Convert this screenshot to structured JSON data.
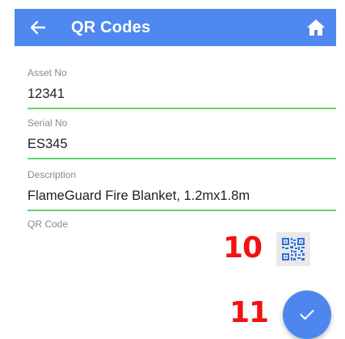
{
  "app_bar": {
    "title": "QR Codes",
    "back_icon": "arrow-left-icon",
    "home_icon": "home-icon",
    "color": "#4f88ef"
  },
  "form": {
    "asset_no": {
      "label": "Asset No",
      "value": "12341"
    },
    "serial_no": {
      "label": "Serial No",
      "value": "ES345"
    },
    "description": {
      "label": "Description",
      "value": "FlameGuard Fire Blanket, 1.2mx1.8m"
    },
    "qr_code": {
      "label": "QR Code",
      "icon": "qr-code-icon"
    },
    "underline_color": "#63d46b"
  },
  "annotations": {
    "step_10": "10",
    "step_11": "11",
    "color": "#f21111"
  },
  "fab": {
    "icon": "check-icon",
    "color": "#4d87ee"
  }
}
